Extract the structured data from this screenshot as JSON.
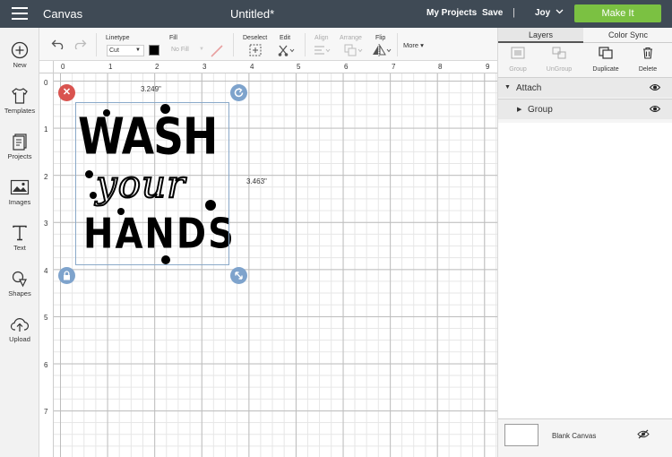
{
  "topbar": {
    "app_title": "Canvas",
    "doc_title": "Untitled*",
    "my_projects": "My Projects",
    "save": "Save",
    "separator": "|",
    "user": "Joy",
    "make_it": "Make It"
  },
  "sidebar": {
    "items": [
      {
        "label": "New",
        "icon": "plus-circle-icon"
      },
      {
        "label": "Templates",
        "icon": "shirt-icon"
      },
      {
        "label": "Projects",
        "icon": "projects-icon"
      },
      {
        "label": "Images",
        "icon": "images-icon"
      },
      {
        "label": "Text",
        "icon": "text-icon"
      },
      {
        "label": "Shapes",
        "icon": "shapes-icon"
      },
      {
        "label": "Upload",
        "icon": "upload-icon"
      }
    ]
  },
  "toolbar": {
    "linetype_label": "Linetype",
    "linetype_value": "Cut",
    "fill_label": "Fill",
    "fill_value": "No Fill",
    "deselect_label": "Deselect",
    "edit_label": "Edit",
    "align_label": "Align",
    "arrange_label": "Arrange",
    "flip_label": "Flip",
    "more_label": "More ▾"
  },
  "canvas": {
    "ruler_top": [
      "0",
      "1",
      "2",
      "3",
      "4",
      "5",
      "6",
      "7",
      "8",
      "9"
    ],
    "ruler_left": [
      "0",
      "1",
      "2",
      "3",
      "4",
      "5",
      "6",
      "7"
    ],
    "width_label": "3.249\"",
    "height_label": "3.463\"",
    "design": {
      "line1": "WASH",
      "line2": "your",
      "line3": "HANDS"
    }
  },
  "right_panel": {
    "tabs": [
      "Layers",
      "Color Sync"
    ],
    "tools": [
      {
        "label": "Group",
        "enabled": false
      },
      {
        "label": "UnGroup",
        "enabled": false
      },
      {
        "label": "Duplicate",
        "enabled": true
      },
      {
        "label": "Delete",
        "enabled": true
      }
    ],
    "layers": [
      {
        "label": "Attach"
      },
      {
        "label": "Group"
      }
    ],
    "blank_canvas": "Blank Canvas"
  },
  "colors": {
    "topbar": "#3f4a55",
    "make_it": "#7bc142",
    "delete_handle": "#d9534f",
    "handle": "#7ea3cc"
  }
}
